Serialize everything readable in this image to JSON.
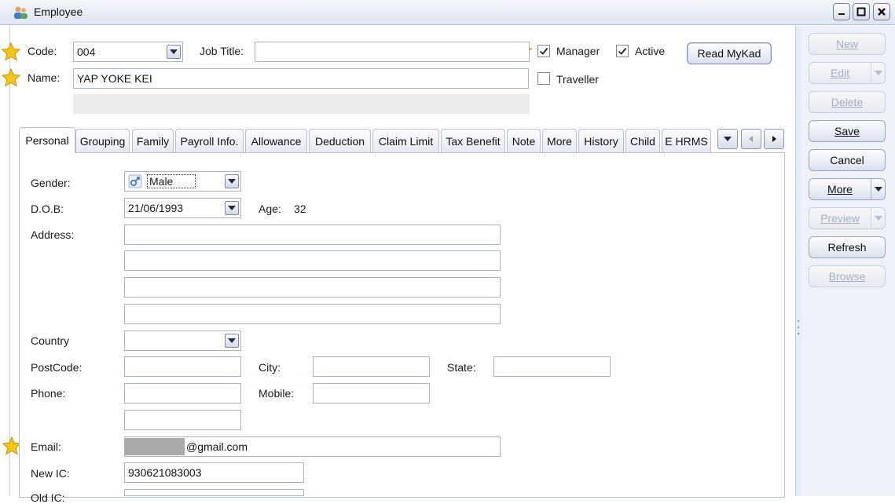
{
  "window": {
    "title": "Employee"
  },
  "header": {
    "code_label": "Code:",
    "code_value": "004",
    "job_title_label": "Job Title:",
    "job_title_value": "",
    "name_label": "Name:",
    "name_value": "YAP YOKE KEI",
    "manager_label": "Manager",
    "manager_checked": true,
    "active_label": "Active",
    "active_checked": true,
    "traveller_label": "Traveller",
    "traveller_checked": false,
    "read_mykad_label": "Read MyKad"
  },
  "tabs": [
    "Personal",
    "Grouping",
    "Family",
    "Payroll Info.",
    "Allowance",
    "Deduction",
    "Claim Limit",
    "Tax Benefit",
    "Note",
    "More",
    "History",
    "Child",
    "E HRMS"
  ],
  "active_tab": "Personal",
  "personal": {
    "gender_label": "Gender:",
    "gender_value": "Male",
    "dob_label": "D.O.B:",
    "dob_value": "21/06/1993",
    "age_label": "Age:",
    "age_value": "32",
    "address_label": "Address:",
    "country_label": "Country",
    "postcode_label": "PostCode:",
    "city_label": "City:",
    "state_label": "State:",
    "phone_label": "Phone:",
    "mobile_label": "Mobile:",
    "email_label": "Email:",
    "email_value": "@gmail.com",
    "newic_label": "New IC:",
    "newic_value": "930621083003",
    "oldic_label": "Old IC:"
  },
  "actions": {
    "new": "New",
    "edit": "Edit",
    "delete": "Delete",
    "save": "Save",
    "cancel": "Cancel",
    "more": "More",
    "preview": "Preview",
    "refresh": "Refresh",
    "browse": "Browse"
  },
  "colors": {
    "star": "#f5c518",
    "accent": "#9aa6c0",
    "disabled_text": "#a9afbd"
  }
}
